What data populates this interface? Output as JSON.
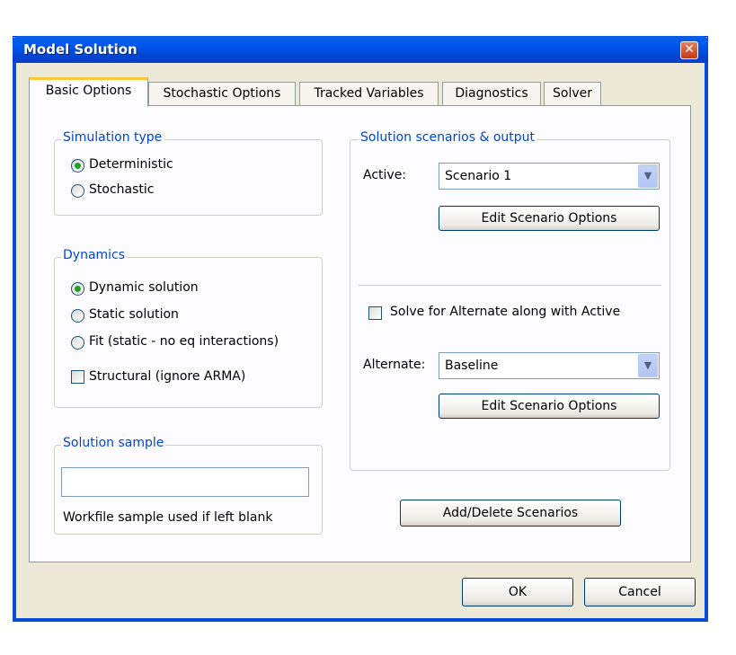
{
  "window": {
    "title": "Model Solution",
    "close_glyph": "✕"
  },
  "tabs": [
    "Basic Options",
    "Stochastic Options",
    "Tracked Variables",
    "Diagnostics",
    "Solver"
  ],
  "simulation_type": {
    "legend": "Simulation type",
    "options": [
      "Deterministic",
      "Stochastic"
    ],
    "selected": "Deterministic"
  },
  "dynamics": {
    "legend": "Dynamics",
    "options": [
      "Dynamic solution",
      "Static solution",
      "Fit (static - no eq interactions)"
    ],
    "selected": "Dynamic solution",
    "structural_label": "Structural (ignore ARMA)",
    "structural_checked": false
  },
  "solution_sample": {
    "legend": "Solution sample",
    "value": "",
    "hint": "Workfile sample used if left blank"
  },
  "scenarios": {
    "legend": "Solution scenarios & output",
    "active_label": "Active:",
    "active_value": "Scenario 1",
    "edit_button_1": "Edit Scenario Options",
    "solve_alternate_label": "Solve for Alternate along with Active",
    "solve_alternate_checked": false,
    "alternate_label": "Alternate:",
    "alternate_value": "Baseline",
    "edit_button_2": "Edit Scenario Options"
  },
  "add_delete_button": "Add/Delete Scenarios",
  "ok_button": "OK",
  "cancel_button": "Cancel",
  "icons": {
    "dropdown": "chevron-down-icon",
    "close": "close-icon"
  },
  "colors": {
    "titlebar": "#0054e3",
    "accent_tab": "#ffc83c",
    "legend_text": "#0046d5",
    "radio_dot": "#21a121"
  }
}
